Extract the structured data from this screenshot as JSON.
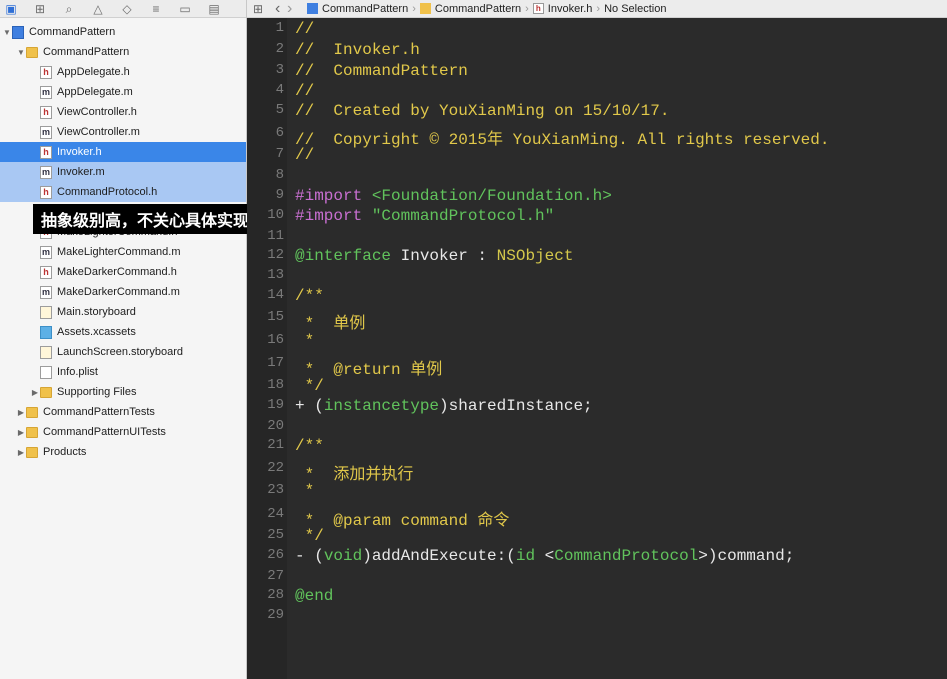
{
  "jumpbar": {
    "back": "‹",
    "forward": "›",
    "crumbs": [
      "CommandPattern",
      "CommandPattern",
      "Invoker.h",
      "No Selection"
    ]
  },
  "tooltip": "抽象级别高，不关心具体实现",
  "tree": [
    {
      "label": "CommandPattern",
      "kind": "proj",
      "indent": 0,
      "disc": "down"
    },
    {
      "label": "CommandPattern",
      "kind": "folder",
      "indent": 1,
      "disc": "down"
    },
    {
      "label": "AppDelegate.h",
      "kind": "h",
      "indent": 2
    },
    {
      "label": "AppDelegate.m",
      "kind": "m",
      "indent": 2
    },
    {
      "label": "ViewController.h",
      "kind": "h",
      "indent": 2
    },
    {
      "label": "ViewController.m",
      "kind": "m",
      "indent": 2
    },
    {
      "label": "Invoker.h",
      "kind": "h",
      "indent": 2,
      "state": "selected"
    },
    {
      "label": "Invoker.m",
      "kind": "m",
      "indent": 2,
      "state": "multi"
    },
    {
      "label": "CommandProtocol.h",
      "kind": "h",
      "indent": 2,
      "state": "multi"
    },
    {
      "label": "",
      "kind": "m",
      "indent": 2
    },
    {
      "label": "MakeLighterCommand.h",
      "kind": "h",
      "indent": 2
    },
    {
      "label": "MakeLighterCommand.m",
      "kind": "m",
      "indent": 2
    },
    {
      "label": "MakeDarkerCommand.h",
      "kind": "h",
      "indent": 2
    },
    {
      "label": "MakeDarkerCommand.m",
      "kind": "m",
      "indent": 2
    },
    {
      "label": "Main.storyboard",
      "kind": "story",
      "indent": 2
    },
    {
      "label": "Assets.xcassets",
      "kind": "assets",
      "indent": 2
    },
    {
      "label": "LaunchScreen.storyboard",
      "kind": "story",
      "indent": 2
    },
    {
      "label": "Info.plist",
      "kind": "plist",
      "indent": 2
    },
    {
      "label": "Supporting Files",
      "kind": "folder",
      "indent": 2,
      "disc": "right"
    },
    {
      "label": "CommandPatternTests",
      "kind": "folder",
      "indent": 1,
      "disc": "right"
    },
    {
      "label": "CommandPatternUITests",
      "kind": "folder",
      "indent": 1,
      "disc": "right"
    },
    {
      "label": "Products",
      "kind": "folder",
      "indent": 1,
      "disc": "right"
    }
  ],
  "code": [
    {
      "n": "1",
      "parts": [
        [
          "comment",
          "//"
        ]
      ]
    },
    {
      "n": "2",
      "parts": [
        [
          "comment",
          "//  Invoker.h"
        ]
      ]
    },
    {
      "n": "3",
      "parts": [
        [
          "comment",
          "//  CommandPattern"
        ]
      ]
    },
    {
      "n": "4",
      "parts": [
        [
          "comment",
          "//"
        ]
      ]
    },
    {
      "n": "5",
      "parts": [
        [
          "comment",
          "//  Created by YouXianMing on 15/10/17."
        ]
      ]
    },
    {
      "n": "6",
      "parts": [
        [
          "comment",
          "//  Copyright © 2015年 YouXianMing. All rights reserved."
        ]
      ]
    },
    {
      "n": "7",
      "parts": [
        [
          "comment",
          "//"
        ]
      ]
    },
    {
      "n": "8",
      "parts": []
    },
    {
      "n": "9",
      "parts": [
        [
          "pre",
          "#import "
        ],
        [
          "proto",
          "<Foundation/Foundation.h>"
        ]
      ]
    },
    {
      "n": "10",
      "parts": [
        [
          "pre",
          "#import "
        ],
        [
          "proto",
          "\"CommandProtocol.h\""
        ]
      ]
    },
    {
      "n": "11",
      "parts": []
    },
    {
      "n": "12",
      "parts": [
        [
          "kw",
          "@interface"
        ],
        [
          "plain",
          " Invoker : "
        ],
        [
          "type",
          "NSObject"
        ]
      ]
    },
    {
      "n": "13",
      "parts": []
    },
    {
      "n": "14",
      "parts": [
        [
          "comment",
          "/**"
        ]
      ]
    },
    {
      "n": "15",
      "parts": [
        [
          "comment",
          " *  单例"
        ]
      ]
    },
    {
      "n": "16",
      "parts": [
        [
          "comment",
          " *"
        ]
      ]
    },
    {
      "n": "17",
      "parts": [
        [
          "comment",
          " *  @return 单例"
        ]
      ]
    },
    {
      "n": "18",
      "parts": [
        [
          "comment",
          " */"
        ]
      ]
    },
    {
      "n": "19",
      "parts": [
        [
          "plain",
          "+ ("
        ],
        [
          "kw",
          "instancetype"
        ],
        [
          "plain",
          ")sharedInstance;"
        ]
      ]
    },
    {
      "n": "20",
      "parts": []
    },
    {
      "n": "21",
      "parts": [
        [
          "comment",
          "/**"
        ]
      ]
    },
    {
      "n": "22",
      "parts": [
        [
          "comment",
          " *  添加并执行"
        ]
      ]
    },
    {
      "n": "23",
      "parts": [
        [
          "comment",
          " *"
        ]
      ]
    },
    {
      "n": "24",
      "parts": [
        [
          "comment",
          " *  @param command 命令"
        ]
      ]
    },
    {
      "n": "25",
      "parts": [
        [
          "comment",
          " */"
        ]
      ]
    },
    {
      "n": "26",
      "parts": [
        [
          "plain",
          "- ("
        ],
        [
          "kw",
          "void"
        ],
        [
          "plain",
          ")addAndExecute:("
        ],
        [
          "kw",
          "id"
        ],
        [
          "plain",
          " <"
        ],
        [
          "proto",
          "CommandProtocol"
        ],
        [
          "plain",
          ">)command;"
        ]
      ]
    },
    {
      "n": "27",
      "parts": []
    },
    {
      "n": "28",
      "parts": [
        [
          "kw",
          "@end"
        ]
      ]
    },
    {
      "n": "29",
      "parts": []
    }
  ]
}
